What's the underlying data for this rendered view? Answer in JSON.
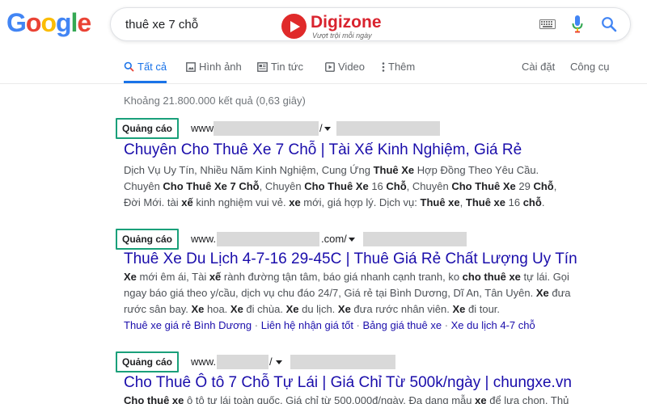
{
  "logo": {
    "letters": [
      "G",
      "o",
      "o",
      "g",
      "l",
      "e"
    ],
    "colors": [
      "#4285f4",
      "#ea4335",
      "#fbbc05",
      "#4285f4",
      "#34a853",
      "#ea4335"
    ]
  },
  "search": {
    "query": "thuê xe 7 chỗ"
  },
  "watermark": {
    "name": "Digizone",
    "tagline": "Vượt trội mỗi ngày"
  },
  "tabs": [
    {
      "label": "Tất cả",
      "icon": "search-icon",
      "active": true
    },
    {
      "label": "Hình ảnh",
      "icon": "image-icon"
    },
    {
      "label": "Tin tức",
      "icon": "news-icon"
    },
    {
      "label": "Video",
      "icon": "video-icon"
    },
    {
      "label": "Thêm",
      "icon": "more-vert-icon"
    }
  ],
  "tools": {
    "settings": "Cài đặt",
    "tools": "Công cụ"
  },
  "stats": "Khoảng 21.800.000 kết quả (0,63 giây)",
  "results": [
    {
      "badge": "Quảng cáo",
      "url_prefix": "www",
      "url_suffix": "/",
      "title": "Chuyên Cho Thuê Xe 7 Chỗ | Tài Xế Kinh Nghiệm, Giá Rẻ",
      "snippet_lines": [
        [
          [
            "Dịch Vụ Uy Tín, Nhiều Năm Kinh Nghiệm, Cung Ứng ",
            false
          ],
          [
            "Thuê Xe",
            true
          ],
          [
            " Hợp Đồng Theo Yêu Cầu.",
            false
          ]
        ],
        [
          [
            "Chuyên ",
            false
          ],
          [
            "Cho Thuê Xe 7 Chỗ",
            true
          ],
          [
            ", Chuyên ",
            false
          ],
          [
            "Cho Thuê Xe",
            true
          ],
          [
            " 16 ",
            false
          ],
          [
            "Chỗ",
            true
          ],
          [
            ", Chuyên ",
            false
          ],
          [
            "Cho Thuê Xe",
            true
          ],
          [
            " 29 ",
            false
          ],
          [
            "Chỗ",
            true
          ],
          [
            ",",
            false
          ]
        ],
        [
          [
            "Đời Mới. tài ",
            false
          ],
          [
            "xế",
            true
          ],
          [
            " kinh nghiệm vui vẻ. ",
            false
          ],
          [
            "xe",
            true
          ],
          [
            " mới, giá hợp lý. Dịch vụ: ",
            false
          ],
          [
            "Thuê xe",
            true
          ],
          [
            ", ",
            false
          ],
          [
            "Thuê xe",
            true
          ],
          [
            " 16 ",
            false
          ],
          [
            "chỗ",
            true
          ],
          [
            ".",
            false
          ]
        ]
      ]
    },
    {
      "badge": "Quảng cáo",
      "url_prefix": "www.",
      "url_suffix": ".com/",
      "title": "Thuê Xe Du Lịch 4-7-16 29-45C | Thuê Giá Rẻ Chất Lượng Uy Tín",
      "snippet_lines": [
        [
          [
            "Xe",
            true
          ],
          [
            " mới êm ái, Tài ",
            false
          ],
          [
            "xế",
            true
          ],
          [
            " rành đường tận tâm, báo giá nhanh cạnh tranh, ko ",
            false
          ],
          [
            "cho thuê xe",
            true
          ],
          [
            " tự lái. Gọi",
            false
          ]
        ],
        [
          [
            "ngay báo giá theo y/cầu, dịch vụ chu đáo 24/7, Giá rẻ tại Bình Dương, Dĩ An, Tân Uyên. ",
            false
          ],
          [
            "Xe",
            true
          ],
          [
            " đưa",
            false
          ]
        ],
        [
          [
            "rước sân bay. ",
            false
          ],
          [
            "Xe",
            true
          ],
          [
            " hoa. ",
            false
          ],
          [
            "Xe",
            true
          ],
          [
            " đi chùa. ",
            false
          ],
          [
            "Xe",
            true
          ],
          [
            " du lịch. ",
            false
          ],
          [
            "Xe",
            true
          ],
          [
            " đưa rước nhân viên. ",
            false
          ],
          [
            "Xe",
            true
          ],
          [
            " đi tour.",
            false
          ]
        ]
      ],
      "sitelinks": [
        "Thuê xe giá rẻ Bình Dương",
        "Liên hệ nhận giá tốt",
        "Bảng giá thuê xe",
        "Xe du lịch 4-7 chỗ"
      ]
    },
    {
      "badge": "Quảng cáo",
      "url_prefix": "www.",
      "url_suffix": "/",
      "title": "Cho Thuê Ô tô 7 Chỗ Tự Lái | Giá Chỉ Từ 500k/ngày | chungxe.vn",
      "snippet_lines": [
        [
          [
            "Cho thuê xe",
            true
          ],
          [
            " ô tô tự lái toàn quốc. Giá chỉ từ 500.000đ/ngày. Đa dạng mẫu ",
            false
          ],
          [
            "xe",
            true
          ],
          [
            " để lựa chọn. Thủ",
            false
          ]
        ]
      ]
    }
  ]
}
